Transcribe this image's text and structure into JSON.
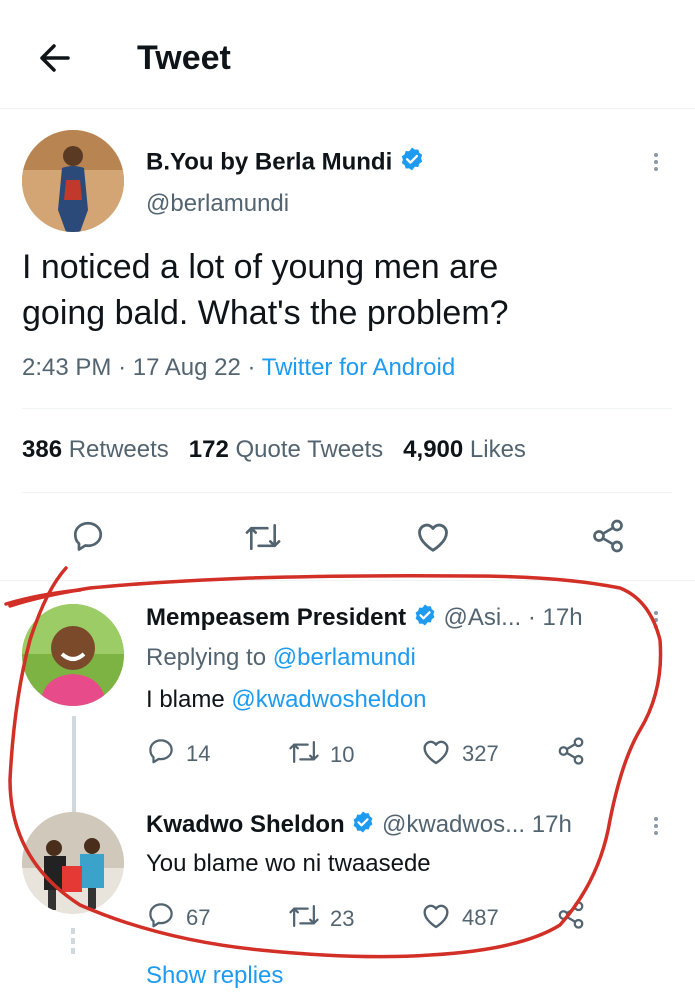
{
  "header": {
    "title": "Tweet"
  },
  "tweet": {
    "author_name": "B.You by Berla Mundi",
    "handle": "@berlamundi",
    "text_line1": "I noticed a lot of young men are",
    "text_line2": "going bald. What's the problem?",
    "time": "2:43 PM",
    "date": "17 Aug 22",
    "source": "Twitter for Android",
    "sep": "·",
    "stats": {
      "retweets_num": "386",
      "retweets_label": "Retweets",
      "quotes_num": "172",
      "quotes_label": "Quote Tweets",
      "likes_num": "4,900",
      "likes_label": "Likes"
    }
  },
  "replies": [
    {
      "name": "Mempeasem President",
      "handle": "@Asi...",
      "time": "· 17h",
      "replying_prefix": "Replying to",
      "replying_to": "@berlamundi",
      "text_prefix": "I blame",
      "text_mention": "@kwadwosheldon",
      "replies": "14",
      "retweets": "10",
      "likes": "327"
    },
    {
      "name": "Kwadwo Sheldon",
      "handle": "@kwadwos...",
      "time": "17h",
      "text": "You blame wo ni twaasede",
      "replies": "67",
      "retweets": "23",
      "likes": "487"
    }
  ],
  "show_replies": "Show replies",
  "colors": {
    "accent": "#1d9bf0",
    "annotation": "#d22f27",
    "verified": "#1d9bf0"
  }
}
